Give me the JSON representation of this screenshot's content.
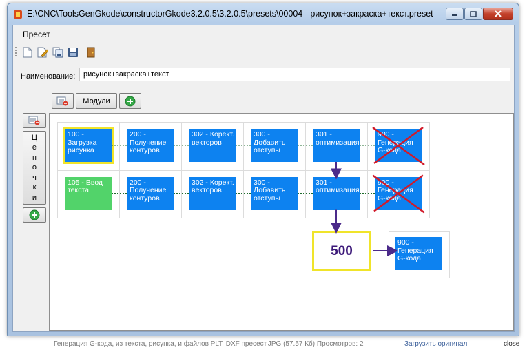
{
  "window": {
    "title": "E:\\CNC\\ToolsGenGkode\\constructorGkode3.2.0.5\\3.2.0.5\\presets\\00004 - рисунок+закраска+текст.preset"
  },
  "menu": {
    "items": [
      "Пресет"
    ]
  },
  "toolbar": {
    "icons": [
      "new-file-icon",
      "edit-file-icon",
      "copy-icon",
      "save-icon",
      "exit-door-icon"
    ]
  },
  "form": {
    "name_label": "Наименование:",
    "name_value": "рисунок+закраска+текст"
  },
  "panel": {
    "modules_label": "Модули",
    "chains_letters": [
      "Ц",
      "е",
      "п",
      "о",
      "ч",
      "к",
      "и"
    ]
  },
  "chains": [
    {
      "nodes": [
        {
          "label": "100 - Загрузка рисунка",
          "color": "#0d82f0",
          "selected": true,
          "crossed": false
        },
        {
          "label": "200 - Получение контуров",
          "color": "#0d82f0",
          "selected": false,
          "crossed": false
        },
        {
          "label": "302 - Корект. векторов",
          "color": "#0d82f0",
          "selected": false,
          "crossed": false
        },
        {
          "label": "300 - Добавить отступы",
          "color": "#0d82f0",
          "selected": false,
          "crossed": false
        },
        {
          "label": "301 - оптимизация",
          "color": "#0d82f0",
          "selected": false,
          "crossed": false
        },
        {
          "label": "900 - Генерация G-кода",
          "color": "#0d82f0",
          "selected": false,
          "crossed": true
        }
      ]
    },
    {
      "nodes": [
        {
          "label": "105 - Ввод текста",
          "color": "#52d36a",
          "selected": false,
          "crossed": false
        },
        {
          "label": "200 - Получение контуров",
          "color": "#0d82f0",
          "selected": false,
          "crossed": false
        },
        {
          "label": "302 - Корект. векторов",
          "color": "#0d82f0",
          "selected": false,
          "crossed": false
        },
        {
          "label": "300 - Добавить отступы",
          "color": "#0d82f0",
          "selected": false,
          "crossed": false
        },
        {
          "label": "301 - оптимизация",
          "color": "#0d82f0",
          "selected": false,
          "crossed": false
        },
        {
          "label": "900 - Генерация G-кода",
          "color": "#0d82f0",
          "selected": false,
          "crossed": true
        }
      ]
    }
  ],
  "merge": {
    "node_label": "500",
    "output_label": "900 - Генерация G-кода"
  },
  "colors": {
    "node_blue": "#0d82f0",
    "node_green": "#52d36a",
    "highlight": "#f0e42a",
    "cross": "#d11a2a",
    "arrow": "#4b2a8a"
  },
  "caption": {
    "text": "Генерация G-кода, из текста, рисунка, и файлов PLT, DXF пресест.JPG (57.57 Кб) Просмотров: 2",
    "link": "Загрузить оригинал",
    "close": "close"
  }
}
